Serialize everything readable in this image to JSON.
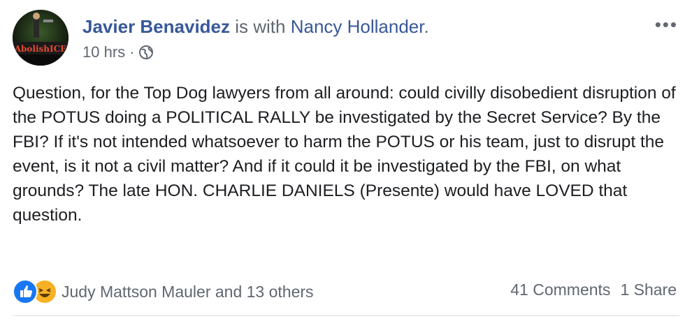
{
  "post": {
    "author_name": "Javier Benavidez",
    "with_text": " is with ",
    "tagged_name": "Nancy Hollander",
    "tagged_suffix": ".",
    "time": "10 hrs",
    "separator": "·",
    "privacy_icon": "globe-icon",
    "more_icon": "more-options-icon",
    "more_label": "•••",
    "avatar_text": "AbolishICE",
    "body": "Question, for the Top Dog lawyers from all around: could civilly disobedient disruption of the POTUS doing a POLITICAL RALLY be investigated by the Secret Service? By the FBI? If it's not intended whatsoever to harm the POTUS or his team, just to disrupt the event, is it not a civil matter? And if it could it be investigated by the FBI, on what grounds? The late HON. CHARLIE DANIELS (Presente) would have LOVED that question."
  },
  "footer": {
    "reaction_icons": [
      "like-icon",
      "haha-icon"
    ],
    "reactors_text": "Judy Mattson Mauler and 13 others",
    "comments_text": "41 Comments",
    "shares_text": "1 Share"
  },
  "colors": {
    "link": "#385898",
    "muted": "#606770",
    "text": "#1c1e21",
    "like_blue": "#1877f2",
    "haha_yellow": "#f7b125"
  }
}
